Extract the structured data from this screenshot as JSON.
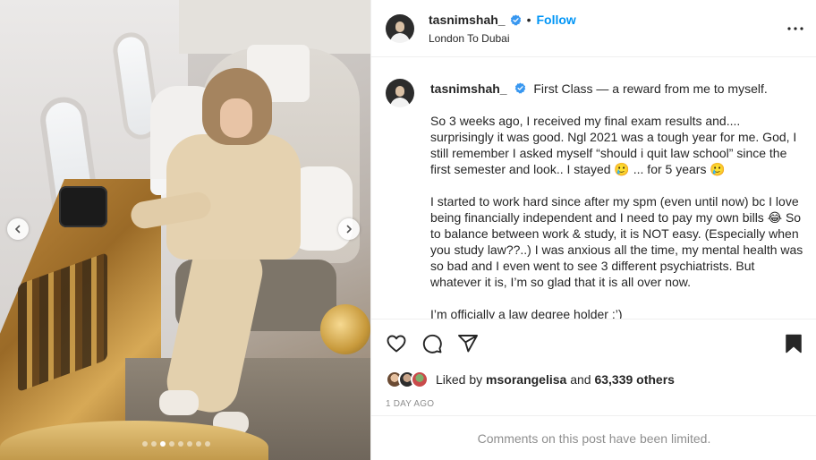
{
  "post_header": {
    "username": "tasnimshah_",
    "follow_label": "Follow",
    "bullet": "•",
    "location": "London To Dubai"
  },
  "caption": {
    "username": "tasnimshah_",
    "paragraphs": [
      "First Class — a reward from me to myself.",
      "So 3 weeks ago, I received my final exam results and.... surprisingly it was good. Ngl 2021 was a tough year for me. God, I still remember I asked myself “should i quit law school” since the first semester and look.. I stayed 🥲 ... for 5 years 🥲",
      "I started to work hard since after my spm (even until now) bc I love being financially independent and I need to pay my own bills 😂 So to balance between work & study, it is NOT easy. (Especially when you study law??..) I was anxious all the time, my mental health was so bad and I even went to see 3 different psychiatrists. But whatever it is, I’m so glad that it is all over now.",
      "I’m officially a law degree holder :’)"
    ]
  },
  "likes": {
    "prefix": "Liked by",
    "first_user": "msorangelisa",
    "and": "and",
    "others": "63,339 others"
  },
  "timestamp": "1 DAY AGO",
  "comments_limited": "Comments on this post have been limited.",
  "carousel": {
    "slide_count": 8,
    "active_index": 2
  },
  "colors": {
    "accent": "#0095f6",
    "verified": "#3897f0",
    "muted": "#8e8e8e"
  },
  "icons": {
    "like": "heart-icon",
    "comment": "comment-icon",
    "share": "paper-plane-icon",
    "save": "bookmark-icon",
    "more": "more-options-icon",
    "prev": "chevron-left-icon",
    "next": "chevron-right-icon"
  }
}
